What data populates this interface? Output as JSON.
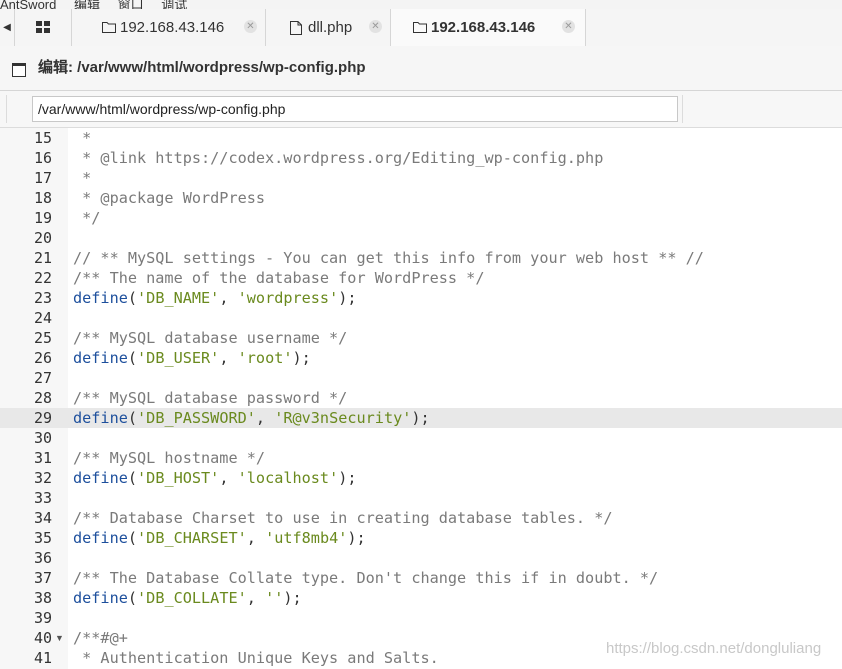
{
  "app": {
    "menu": [
      "AntSword",
      "编辑",
      "窗口",
      "调试"
    ]
  },
  "tabs": [
    {
      "label": "192.168.43.146",
      "icon": "folder-icon",
      "active": false
    },
    {
      "label": "dll.php",
      "icon": "file-icon",
      "active": false
    },
    {
      "label": "192.168.43.146",
      "icon": "folder-icon",
      "active": true
    }
  ],
  "window": {
    "title": "编辑: /var/www/html/wordpress/wp-config.php"
  },
  "path_input": {
    "value": "/var/www/html/wordpress/wp-config.php"
  },
  "editor": {
    "active_line": 29,
    "lines": [
      {
        "n": "15",
        "code": " *"
      },
      {
        "n": "16",
        "code": " * @link https://codex.wordpress.org/Editing_wp-config.php"
      },
      {
        "n": "17",
        "code": " *"
      },
      {
        "n": "18",
        "code": " * @package WordPress"
      },
      {
        "n": "19",
        "code": " */"
      },
      {
        "n": "20",
        "code": ""
      },
      {
        "n": "21",
        "code": "// ** MySQL settings - You can get this info from your web host ** //"
      },
      {
        "n": "22",
        "code": "/** The name of the database for WordPress */"
      },
      {
        "n": "23",
        "code": "define('DB_NAME', 'wordpress');"
      },
      {
        "n": "24",
        "code": ""
      },
      {
        "n": "25",
        "code": "/** MySQL database username */"
      },
      {
        "n": "26",
        "code": "define('DB_USER', 'root');"
      },
      {
        "n": "27",
        "code": ""
      },
      {
        "n": "28",
        "code": "/** MySQL database password */"
      },
      {
        "n": "29",
        "code": "define('DB_PASSWORD', 'R@v3nSecurity');"
      },
      {
        "n": "30",
        "code": ""
      },
      {
        "n": "31",
        "code": "/** MySQL hostname */"
      },
      {
        "n": "32",
        "code": "define('DB_HOST', 'localhost');"
      },
      {
        "n": "33",
        "code": ""
      },
      {
        "n": "34",
        "code": "/** Database Charset to use in creating database tables. */"
      },
      {
        "n": "35",
        "code": "define('DB_CHARSET', 'utf8mb4');"
      },
      {
        "n": "36",
        "code": ""
      },
      {
        "n": "37",
        "code": "/** The Database Collate type. Don't change this if in doubt. */"
      },
      {
        "n": "38",
        "code": "define('DB_COLLATE', '');"
      },
      {
        "n": "39",
        "code": ""
      },
      {
        "n": "40",
        "code": "/**#@+",
        "fold": true
      },
      {
        "n": "41",
        "code": " * Authentication Unique Keys and Salts."
      }
    ]
  },
  "watermark": "https://blog.csdn.net/dongluliang",
  "colors": {
    "comment": "#7a7a7a",
    "keyword": "#1d4f9c",
    "string": "#6a8a1e",
    "active_line": "#e8e8e8"
  }
}
